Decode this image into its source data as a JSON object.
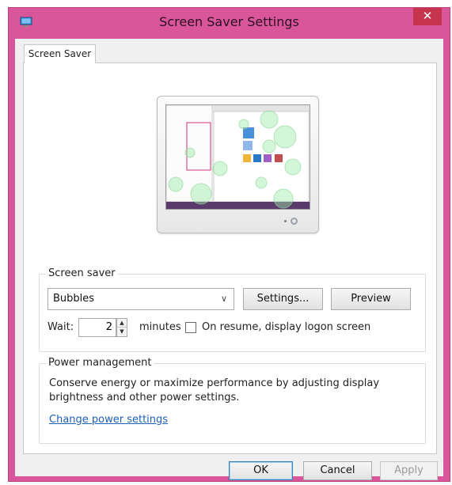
{
  "window": {
    "title": "Screen Saver Settings",
    "icon": "monitor-app-icon",
    "close_label": "✕"
  },
  "tabs": [
    {
      "label": "Screen Saver",
      "selected": true
    }
  ],
  "screen_saver": {
    "group_label": "Screen saver",
    "selected": "Bubbles",
    "settings_label": "Settings...",
    "preview_label": "Preview",
    "wait_label": "Wait:",
    "wait_value": "2",
    "minutes_label": "minutes",
    "on_resume_label": "On resume, display logon screen",
    "on_resume_checked": false
  },
  "power": {
    "group_label": "Power management",
    "description_line1": "Conserve energy or maximize performance by adjusting display",
    "description_line2": "brightness and other power settings.",
    "link": "Change power settings"
  },
  "buttons": {
    "ok": "OK",
    "cancel": "Cancel",
    "apply": "Apply"
  },
  "colors": {
    "frame": "#d9569b",
    "close": "#c7344d",
    "link": "#1e5fb4"
  }
}
